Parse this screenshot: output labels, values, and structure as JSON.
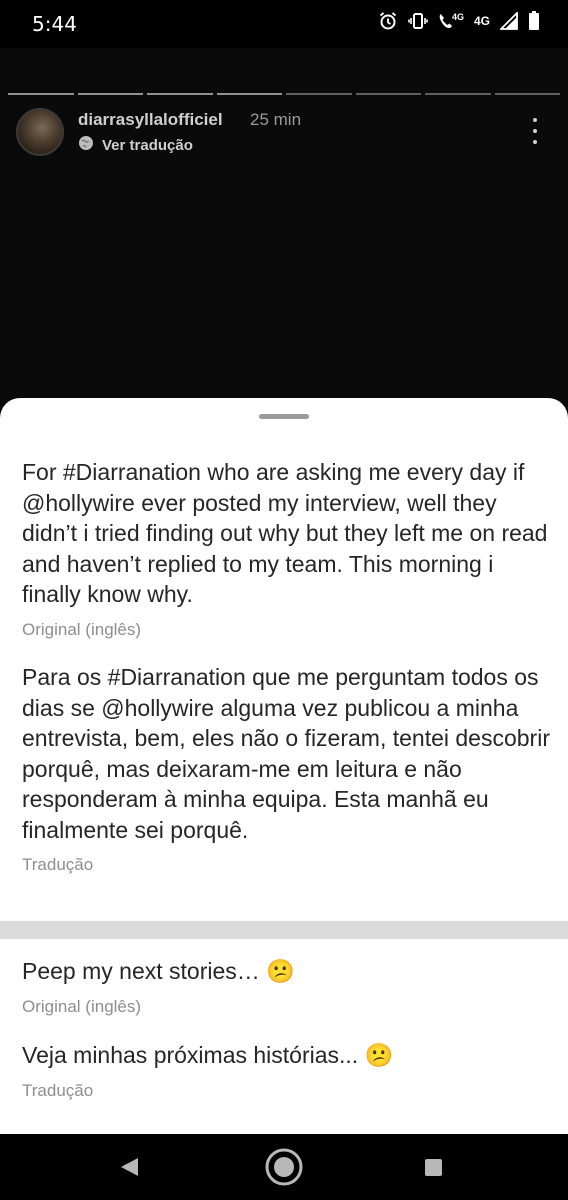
{
  "status_bar": {
    "time": "5:44",
    "network_small": "4G",
    "network": "4G"
  },
  "story": {
    "username": "diarrasyllalofficiel",
    "time_ago": "25 min",
    "translate_label": "Ver tradução",
    "progress_segments": 8
  },
  "captions": [
    {
      "text": "For #Diarranation who are asking me every day if @hollywire ever posted my interview, well they didn’t i tried finding out why but they left me on read and haven’t replied to my team. This morning i finally know why.",
      "label": "Original (inglês)"
    },
    {
      "text": "Para os #Diarranation que me perguntam todos os dias se @hollywire alguma vez publicou a minha entrevista, bem, eles não o fizeram, tentei descobrir porquê, mas deixaram-me em leitura e não responderam à minha equipa. Esta manhã eu finalmente sei porquê.",
      "label": "Tradução"
    },
    {
      "text": "Peep my next stories… 😕",
      "label": "Original (inglês)"
    },
    {
      "text": "Veja minhas próximas histórias... 😕",
      "label": "Tradução"
    }
  ],
  "icons": {
    "alarm": "alarm-icon",
    "vibrate": "vibrate-icon",
    "call": "wifi-call-icon",
    "signal": "signal-icon",
    "battery": "battery-icon",
    "globe": "globe-icon",
    "more": "more-vertical-icon",
    "back": "back-icon",
    "home": "home-icon",
    "recents": "recents-icon"
  }
}
